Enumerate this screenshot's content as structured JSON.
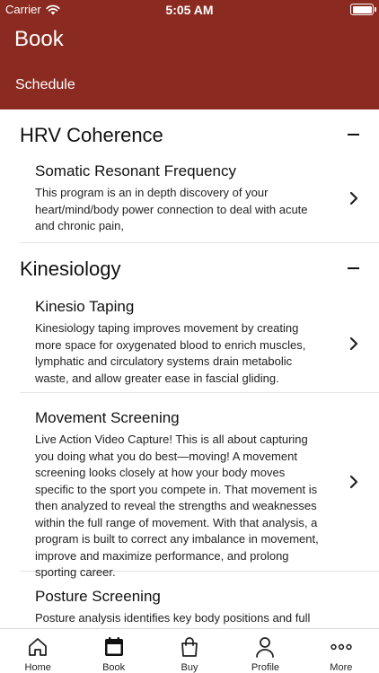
{
  "status_bar": {
    "carrier": "Carrier",
    "time": "5:05 AM"
  },
  "header": {
    "title": "Book",
    "sub_tab": "Schedule"
  },
  "sections": [
    {
      "title": "HRV Coherence",
      "items": [
        {
          "title": "Somatic Resonant Frequency",
          "description": "This program is an in depth discovery of your heart/mind/body power connection to deal with acute and chronic pain,"
        }
      ]
    },
    {
      "title": "Kinesiology",
      "items": [
        {
          "title": "Kinesio Taping",
          "description": "Kinesiology taping improves movement by creating more space for oxygenated blood to enrich muscles, lymphatic and circulatory systems drain metabolic waste, and allow greater ease in fascial gliding."
        },
        {
          "title": "Movement Screening",
          "description": "Live Action Video Capture! This is all about capturing you doing what you do best—moving! A movement screening looks closely at how your body moves specific to the sport you compete in. That movement is then analyzed to reveal the strengths and weaknesses within the full range of movement. With that analysis, a program is built to correct any imbalance in movement, improve and maximize performance, and prolong sporting career."
        },
        {
          "title": "Posture Screening",
          "description": "Posture analysis identifies key body positions and full body stances with the goal of realigning the body in relationship to"
        }
      ]
    }
  ],
  "tab_bar": {
    "items": [
      {
        "label": "Home",
        "icon": "home-icon"
      },
      {
        "label": "Book",
        "icon": "calendar-icon"
      },
      {
        "label": "Buy",
        "icon": "shopping-bag-icon"
      },
      {
        "label": "Profile",
        "icon": "person-icon"
      },
      {
        "label": "More",
        "icon": "more-dots-icon"
      }
    ],
    "active_index": 1
  },
  "colors": {
    "header_bg": "#8b2a20",
    "text": "#111111"
  }
}
